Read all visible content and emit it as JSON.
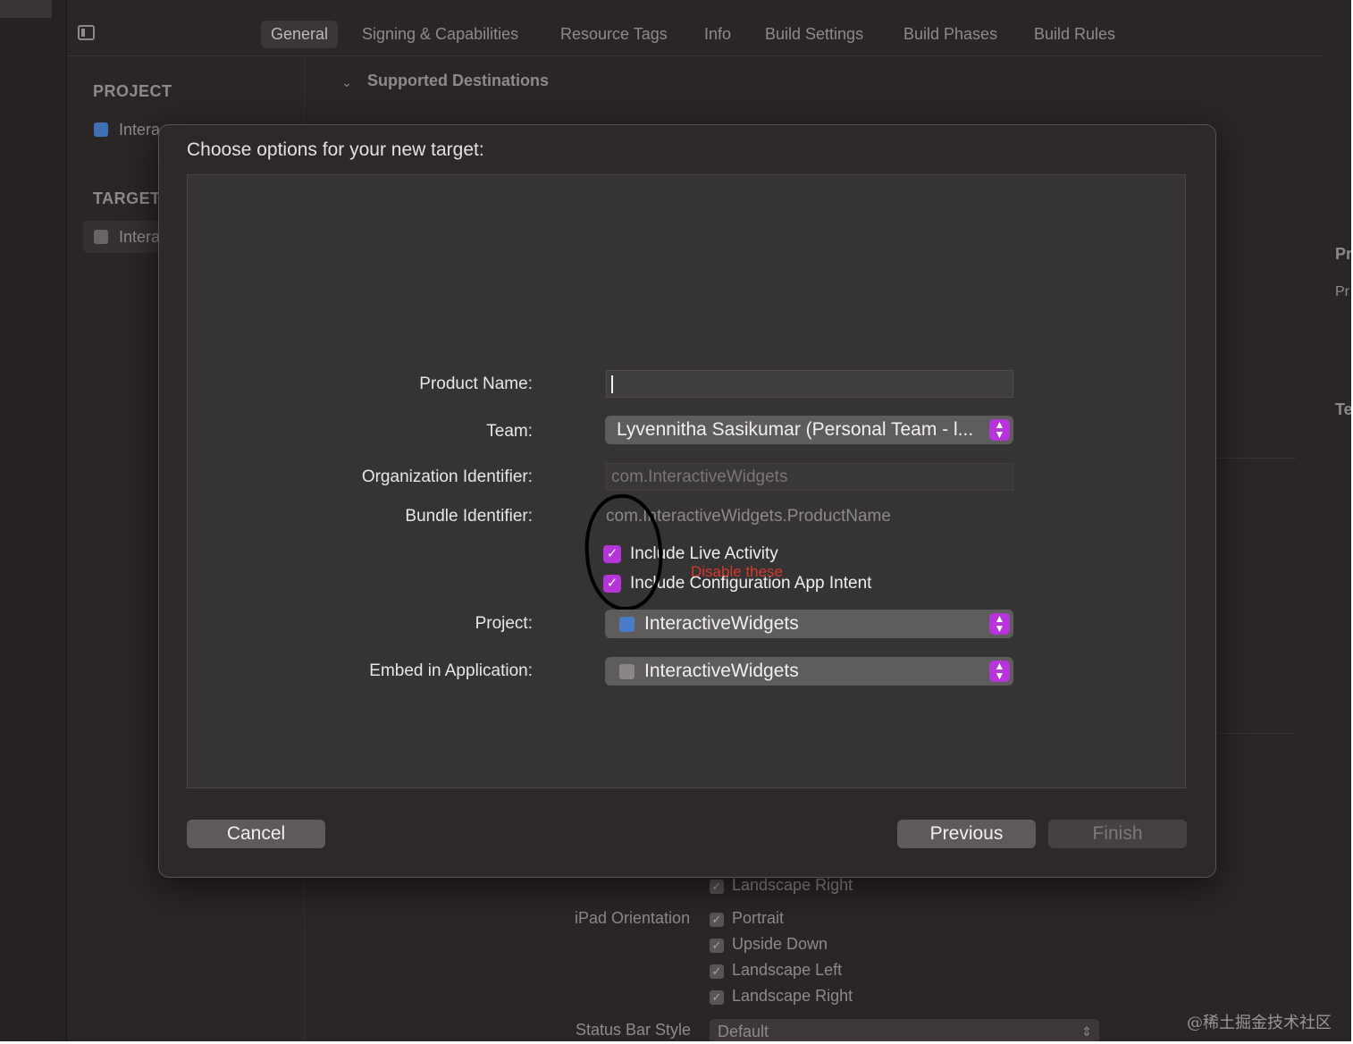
{
  "toolbar": {
    "tabs": [
      "General",
      "Signing & Capabilities",
      "Resource Tags",
      "Info",
      "Build Settings",
      "Build Phases",
      "Build Rules"
    ]
  },
  "sidebar": {
    "project_heading": "PROJECT",
    "project_item": "Intera",
    "targets_heading": "TARGET",
    "target_item": "Intera"
  },
  "content": {
    "section_heading": "Supported Destinations",
    "right_fragments": [
      "Pr",
      "Pr",
      "Te"
    ],
    "behind_dialog": {
      "landscape_right_top": "Landscape Right",
      "ipad_orientation_label": "iPad Orientation",
      "ipad_options": [
        "Portrait",
        "Upside Down",
        "Landscape Left",
        "Landscape Right"
      ],
      "status_bar_label": "Status Bar Style",
      "status_bar_value": "Default"
    }
  },
  "dialog": {
    "title": "Choose options for your new target:",
    "fields": {
      "product_name_label": "Product Name:",
      "product_name_value": "",
      "team_label": "Team:",
      "team_value": "Lyvennitha Sasikumar (Personal Team - l...",
      "org_label": "Organization Identifier:",
      "org_placeholder": "com.InteractiveWidgets",
      "bundle_label": "Bundle Identifier:",
      "bundle_value": "com.InteractiveWidgets.ProductName",
      "include_live_activity": "Include Live Activity",
      "include_config_intent": "Include Configuration App Intent",
      "project_label": "Project:",
      "project_value": "InteractiveWidgets",
      "embed_label": "Embed in Application:",
      "embed_value": "InteractiveWidgets"
    },
    "annotation": "Disable these",
    "buttons": {
      "cancel": "Cancel",
      "previous": "Previous",
      "finish": "Finish"
    }
  },
  "watermark": "@稀土掘金技术社区",
  "colors": {
    "accent": "#b535d8",
    "annotation": "#d23a2f",
    "background": "#2b2626"
  }
}
